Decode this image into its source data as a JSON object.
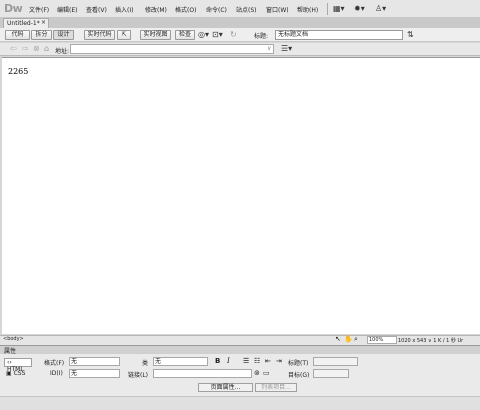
{
  "app": {
    "logo": "Dw"
  },
  "menu": [
    "文件(F)",
    "编辑(E)",
    "查看(V)",
    "插入(I)",
    "修改(M)",
    "格式(O)",
    "命令(C)",
    "站点(S)",
    "窗口(W)",
    "帮助(H)"
  ],
  "tab": {
    "title": "Untitled-1*",
    "close": "×"
  },
  "toolbar": {
    "code": "代码",
    "split": "拆分",
    "design": "设计",
    "live_code": "实时代码",
    "live_view": "实时视图",
    "inspect": "检查",
    "title_label": "标题:",
    "title_value": "无标题文档"
  },
  "address": {
    "label": "地址:"
  },
  "document": {
    "text": "2265"
  },
  "status": {
    "tag": "<body>",
    "zoom": "100%",
    "size": "1020 x 543 ∨ 1 K / 1 秒  Ur"
  },
  "properties": {
    "title": "属性",
    "html": "HTML",
    "css": "CSS",
    "format_label": "格式(F)",
    "format_value": "无",
    "id_label": "ID(I)",
    "id_value": "无",
    "class_label": "类",
    "class_value": "无",
    "link_label": "链接(L)",
    "heading_label": "标题(T)",
    "target_label": "目标(G)",
    "page_props": "页面属性...",
    "list_item": "列表项目..."
  }
}
